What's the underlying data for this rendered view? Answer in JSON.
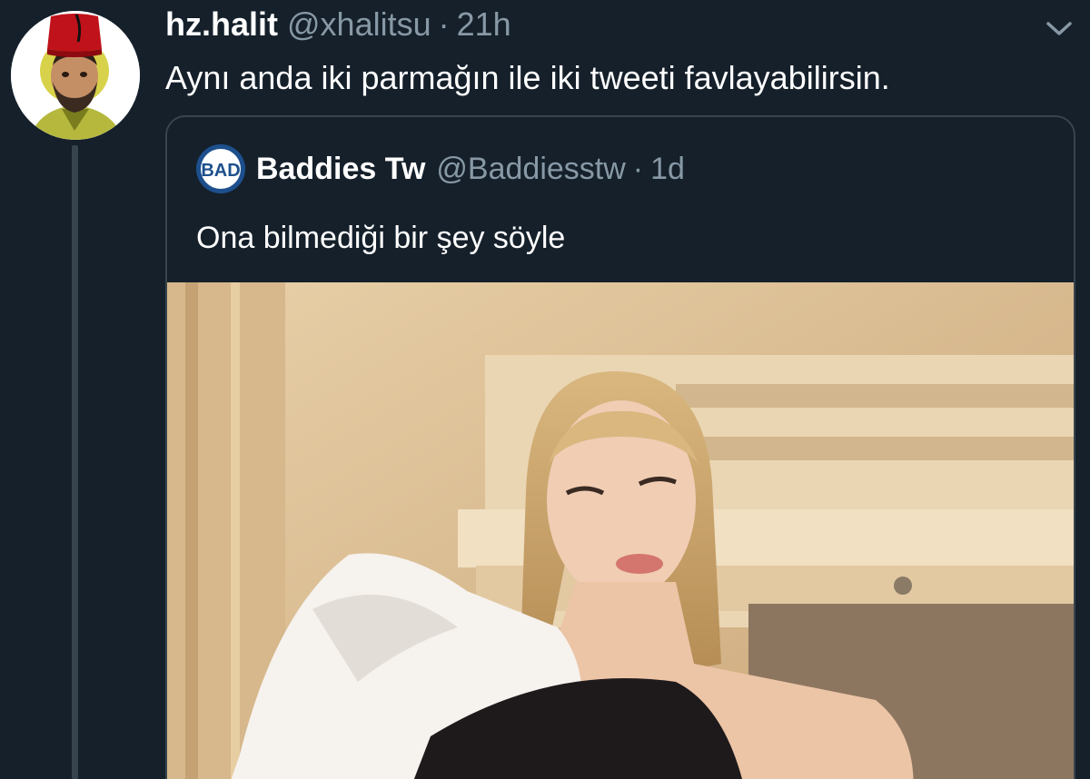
{
  "tweet": {
    "display_name": "hz.halit",
    "handle": "@xhalitsu",
    "separator": "·",
    "time": "21h",
    "text": "Aynı anda iki parmağın ile iki tweeti favlayabilirsin."
  },
  "quoted_tweet": {
    "avatar_text": "BAD",
    "display_name": "Baddies Tw",
    "handle": "@Baddiesstw",
    "separator": "·",
    "time": "1d",
    "text": "Ona bilmediği bir şey söyle"
  },
  "icons": {
    "menu": "chevron-down-icon"
  },
  "colors": {
    "background": "#15202b",
    "border": "#38444d",
    "secondary_text": "#8899a6",
    "primary_text": "#ffffff"
  }
}
